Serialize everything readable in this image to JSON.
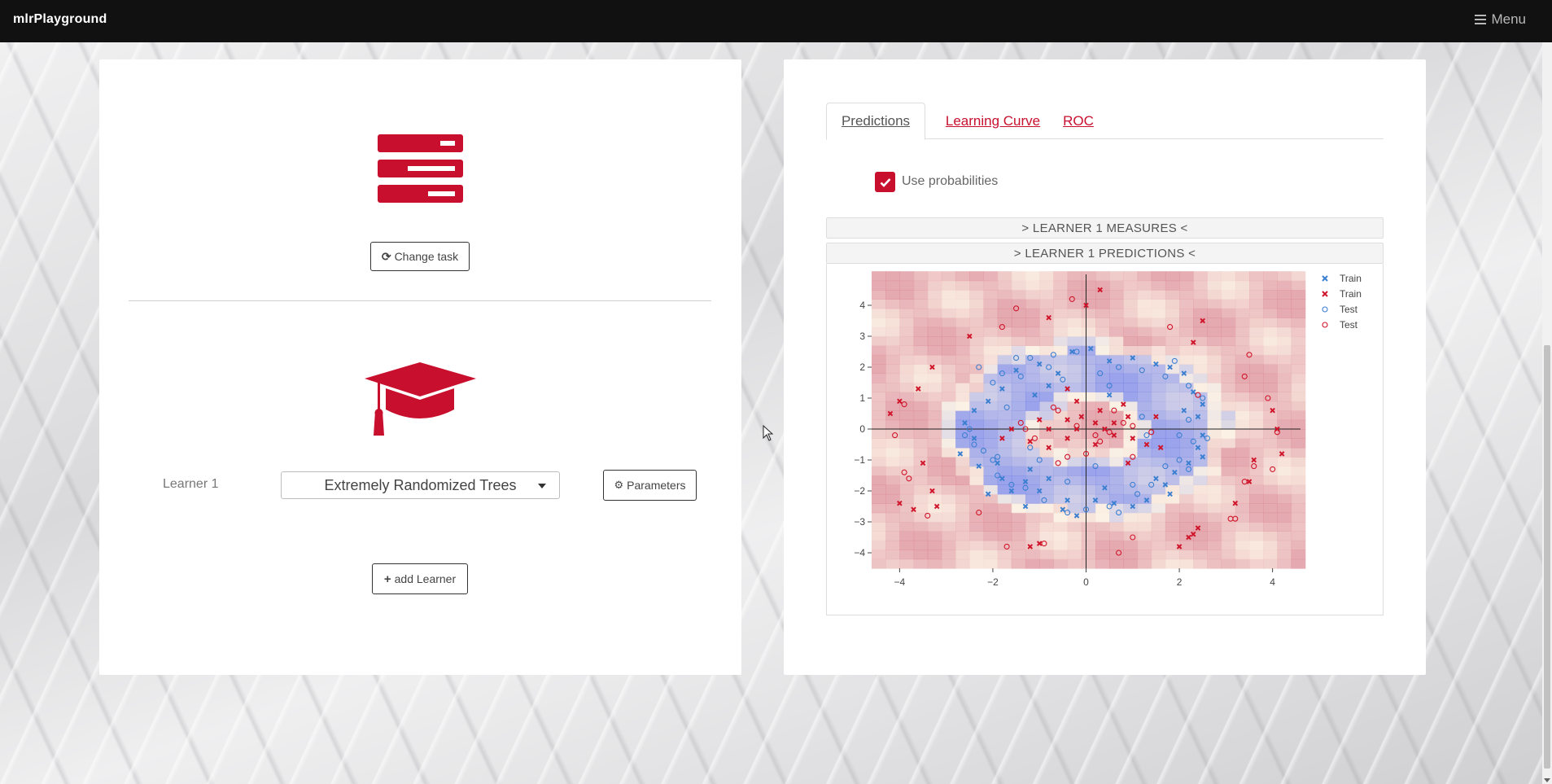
{
  "navbar": {
    "brand": "mlrPlayground",
    "menu_label": "Menu",
    "menu_icon": "bars-icon"
  },
  "task": {
    "icon": "server-icon",
    "change_task_label": "Change task",
    "change_task_icon": "refresh-icon"
  },
  "learner": {
    "icon": "graduation-cap-icon",
    "label": "Learner 1",
    "selected": "Extremely Randomized Trees",
    "parameters_label": "Parameters",
    "parameters_icon": "gear-icon",
    "add_learner_label": "add Learner",
    "add_learner_icon": "plus-icon"
  },
  "tabs": [
    {
      "label": "Predictions",
      "active": true
    },
    {
      "label": "Learning Curve",
      "active": false
    },
    {
      "label": "ROC",
      "active": false
    }
  ],
  "use_probabilities": {
    "label": "Use probabilities",
    "checked": true
  },
  "measures_header": "> LEARNER 1 MEASURES <",
  "predictions_header": "> LEARNER 1 PREDICTIONS <",
  "colors": {
    "accent": "#c8102e",
    "class_blue": "#3b7fd1",
    "class_red": "#d0142a"
  },
  "chart_data": {
    "type": "scatter",
    "xlim": [
      -4.6,
      4.6
    ],
    "ylim": [
      -4.5,
      5.0
    ],
    "x_ticks": [
      -4,
      -2,
      0,
      2,
      4
    ],
    "y_ticks": [
      4,
      3,
      2,
      1,
      0,
      -1,
      -2,
      -3,
      -4
    ],
    "x_tick_labels": [
      "−4",
      "−2",
      "0",
      "2",
      "4"
    ],
    "y_tick_labels": [
      "4",
      "3",
      "2",
      "1",
      "0",
      "−1",
      "−2",
      "−3",
      "−4"
    ],
    "legend_position": "top-right",
    "background": "decision-surface heatmap (blue ring region, red elsewhere)",
    "series": [
      {
        "name": "Train",
        "marker": "x",
        "color": "#3b7fd1",
        "points": [
          [
            -2.3,
            -1.2
          ],
          [
            -2.4,
            -0.3
          ],
          [
            -1.9,
            -1.1
          ],
          [
            -1.8,
            -1.6
          ],
          [
            -1.6,
            -2.0
          ],
          [
            -1.3,
            -1.7
          ],
          [
            -1.0,
            -2.0
          ],
          [
            -0.8,
            -1.6
          ],
          [
            -0.5,
            -2.6
          ],
          [
            -0.2,
            -2.8
          ],
          [
            0.2,
            -2.3
          ],
          [
            0.6,
            -2.4
          ],
          [
            1.0,
            -2.5
          ],
          [
            1.3,
            -2.3
          ],
          [
            1.7,
            -1.8
          ],
          [
            1.9,
            -1.4
          ],
          [
            2.2,
            -1.1
          ],
          [
            2.5,
            -0.9
          ],
          [
            2.4,
            -0.6
          ],
          [
            2.5,
            -0.2
          ],
          [
            2.4,
            0.4
          ],
          [
            2.5,
            0.8
          ],
          [
            2.3,
            1.2
          ],
          [
            2.1,
            1.8
          ],
          [
            1.8,
            2.0
          ],
          [
            1.5,
            2.1
          ],
          [
            1.0,
            2.3
          ],
          [
            0.5,
            2.2
          ],
          [
            0.1,
            2.6
          ],
          [
            -0.3,
            2.5
          ],
          [
            -0.6,
            1.8
          ],
          [
            -1.0,
            2.1
          ],
          [
            -1.5,
            1.9
          ],
          [
            -1.8,
            1.3
          ],
          [
            -2.1,
            0.9
          ],
          [
            -2.4,
            0.6
          ],
          [
            -2.6,
            0.2
          ],
          [
            -2.7,
            -0.8
          ],
          [
            -1.2,
            -1.3
          ],
          [
            -0.4,
            -2.3
          ],
          [
            0.4,
            -1.9
          ],
          [
            1.5,
            -1.6
          ],
          [
            -0.8,
            1.4
          ],
          [
            0.5,
            1.1
          ],
          [
            -1.1,
            1.1
          ],
          [
            1.8,
            -2.1
          ],
          [
            -2.1,
            -2.1
          ],
          [
            2.1,
            0.6
          ],
          [
            -1.3,
            -2.5
          ]
        ]
      },
      {
        "name": "Train",
        "marker": "x",
        "color": "#d0142a",
        "points": [
          [
            0.3,
            4.5
          ],
          [
            0.0,
            4.0
          ],
          [
            -0.8,
            3.6
          ],
          [
            -2.5,
            3.0
          ],
          [
            -3.3,
            2.0
          ],
          [
            -3.6,
            1.3
          ],
          [
            -4.0,
            0.9
          ],
          [
            -4.2,
            0.5
          ],
          [
            -3.5,
            -1.1
          ],
          [
            -3.3,
            -2.0
          ],
          [
            -3.2,
            -2.5
          ],
          [
            -4.0,
            -2.4
          ],
          [
            -3.7,
            -2.6
          ],
          [
            -1.2,
            -3.8
          ],
          [
            -1.0,
            -3.7
          ],
          [
            2.2,
            -3.5
          ],
          [
            2.3,
            -3.4
          ],
          [
            2.4,
            -3.2
          ],
          [
            2.0,
            -3.8
          ],
          [
            3.2,
            -2.4
          ],
          [
            3.5,
            -1.7
          ],
          [
            3.6,
            -1.0
          ],
          [
            4.2,
            -0.8
          ],
          [
            4.1,
            0.0
          ],
          [
            4.0,
            0.6
          ],
          [
            2.5,
            3.5
          ],
          [
            2.3,
            2.8
          ],
          [
            -0.4,
            1.3
          ],
          [
            -0.2,
            0.9
          ],
          [
            0.3,
            0.6
          ],
          [
            0.8,
            0.8
          ],
          [
            0.9,
            0.4
          ],
          [
            0.6,
            0.2
          ],
          [
            0.2,
            0.2
          ],
          [
            -0.2,
            0.0
          ],
          [
            -0.4,
            -0.3
          ],
          [
            -0.8,
            -0.6
          ],
          [
            -1.2,
            -0.4
          ],
          [
            -0.8,
            0.0
          ],
          [
            -1.0,
            0.3
          ],
          [
            -1.6,
            0.0
          ],
          [
            -1.8,
            -0.3
          ],
          [
            0.2,
            -0.5
          ],
          [
            0.6,
            -0.2
          ],
          [
            1.0,
            -0.3
          ],
          [
            1.3,
            -0.5
          ],
          [
            1.6,
            -0.6
          ],
          [
            0.9,
            -1.1
          ],
          [
            0.4,
            0.0
          ],
          [
            -0.1,
            0.4
          ],
          [
            1.5,
            0.4
          ],
          [
            -0.4,
            0.3
          ]
        ]
      },
      {
        "name": "Test",
        "marker": "o",
        "color": "#3b7fd1",
        "points": [
          [
            -2.4,
            -0.5
          ],
          [
            -2.6,
            -0.2
          ],
          [
            -2.2,
            -0.7
          ],
          [
            -2.0,
            -1.0
          ],
          [
            -1.9,
            -1.5
          ],
          [
            -1.6,
            -1.8
          ],
          [
            -1.3,
            -1.9
          ],
          [
            -0.9,
            -2.3
          ],
          [
            -0.4,
            -2.7
          ],
          [
            0.0,
            -2.6
          ],
          [
            0.5,
            -2.5
          ],
          [
            0.7,
            -2.7
          ],
          [
            1.1,
            -2.1
          ],
          [
            1.4,
            -1.8
          ],
          [
            1.7,
            -1.2
          ],
          [
            2.0,
            -1.0
          ],
          [
            2.2,
            -1.3
          ],
          [
            2.3,
            -0.4
          ],
          [
            2.6,
            -0.3
          ],
          [
            2.0,
            -0.2
          ],
          [
            2.2,
            0.3
          ],
          [
            2.5,
            1.0
          ],
          [
            2.2,
            1.4
          ],
          [
            1.9,
            2.2
          ],
          [
            1.7,
            1.7
          ],
          [
            1.2,
            1.9
          ],
          [
            0.7,
            2.0
          ],
          [
            0.3,
            1.8
          ],
          [
            -0.2,
            2.5
          ],
          [
            -0.7,
            2.4
          ],
          [
            -1.2,
            2.3
          ],
          [
            -1.5,
            2.3
          ],
          [
            -1.8,
            1.8
          ],
          [
            -2.0,
            1.5
          ],
          [
            -2.3,
            2.0
          ],
          [
            -1.7,
            0.7
          ],
          [
            -2.5,
            0.0
          ],
          [
            -1.4,
            1.7
          ],
          [
            -0.5,
            1.6
          ],
          [
            -1.2,
            -0.6
          ],
          [
            -1.0,
            -1.0
          ],
          [
            -1.9,
            -0.9
          ],
          [
            1.0,
            -1.8
          ],
          [
            0.2,
            -1.2
          ],
          [
            -0.4,
            -1.7
          ],
          [
            1.2,
            0.4
          ],
          [
            1.3,
            -0.2
          ],
          [
            0.5,
            1.4
          ],
          [
            -0.8,
            2.0
          ]
        ]
      },
      {
        "name": "Test",
        "marker": "o",
        "color": "#d0142a",
        "points": [
          [
            -0.3,
            4.2
          ],
          [
            -1.5,
            3.9
          ],
          [
            -1.8,
            3.3
          ],
          [
            1.8,
            3.3
          ],
          [
            3.5,
            2.4
          ],
          [
            3.4,
            1.7
          ],
          [
            2.4,
            1.1
          ],
          [
            3.9,
            1.0
          ],
          [
            -3.9,
            0.8
          ],
          [
            -4.1,
            -0.2
          ],
          [
            -3.9,
            -1.4
          ],
          [
            -3.8,
            -1.6
          ],
          [
            -3.4,
            -2.8
          ],
          [
            -2.3,
            -2.7
          ],
          [
            -1.7,
            -3.8
          ],
          [
            -0.9,
            -3.7
          ],
          [
            0.7,
            -4.0
          ],
          [
            1.0,
            -3.5
          ],
          [
            3.1,
            -2.9
          ],
          [
            3.2,
            -2.9
          ],
          [
            3.4,
            -1.7
          ],
          [
            3.6,
            -1.2
          ],
          [
            4.0,
            -1.3
          ],
          [
            4.1,
            -0.1
          ],
          [
            -1.3,
            0.0
          ],
          [
            -0.6,
            0.6
          ],
          [
            -0.4,
            -0.9
          ],
          [
            -0.2,
            0.1
          ],
          [
            0.3,
            -0.4
          ],
          [
            0.6,
            0.6
          ],
          [
            0.8,
            0.2
          ],
          [
            1.0,
            0.1
          ],
          [
            1.0,
            -0.9
          ],
          [
            0.0,
            -0.8
          ],
          [
            -0.6,
            -1.1
          ],
          [
            0.5,
            -0.1
          ],
          [
            -0.7,
            0.7
          ],
          [
            1.4,
            -0.1
          ],
          [
            -1.4,
            0.2
          ],
          [
            -1.1,
            -0.3
          ],
          [
            0.2,
            -0.2
          ]
        ]
      }
    ]
  }
}
